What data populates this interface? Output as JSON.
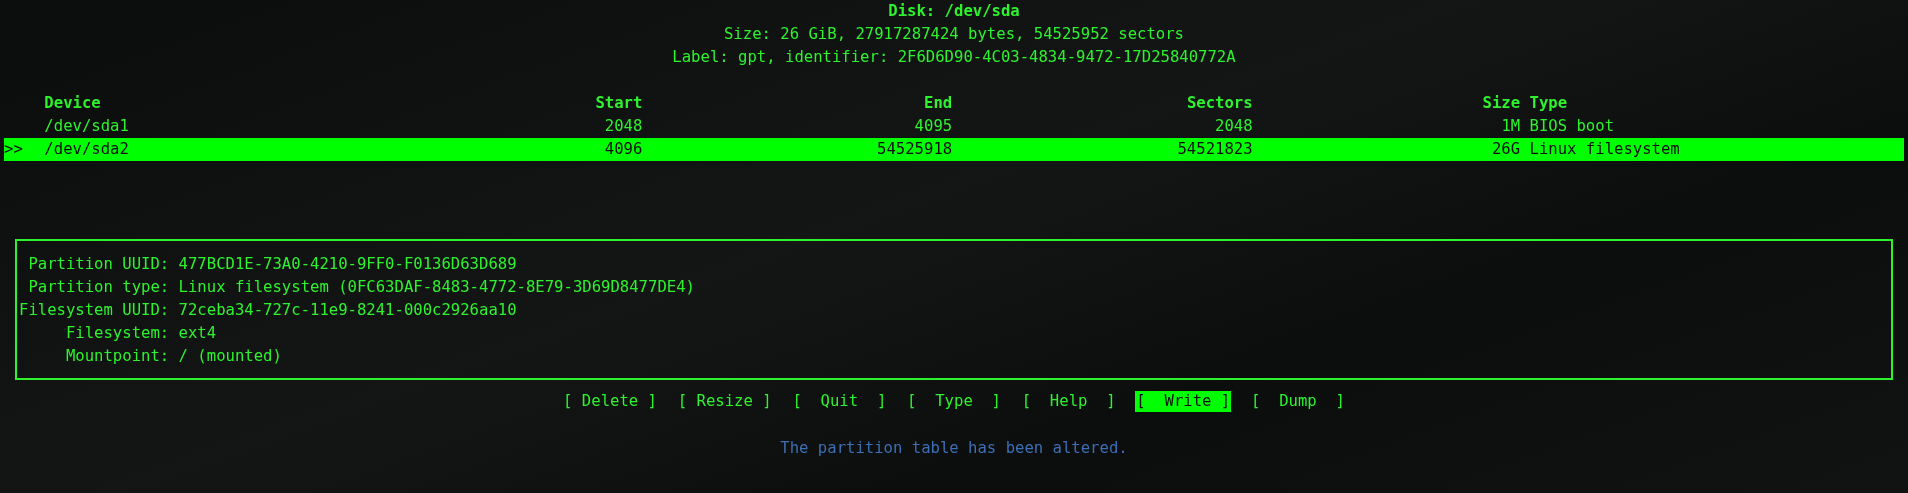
{
  "disk": {
    "title": "Disk: /dev/sda",
    "size_line": "Size: 26 GiB, 27917287424 bytes, 54525952 sectors",
    "label_line": "Label: gpt, identifier: 2F6D6D90-4C03-4834-9472-17D25840772A"
  },
  "table": {
    "columns": [
      "Device",
      "Start",
      "End",
      "Sectors",
      "Size",
      "Type"
    ],
    "rows": [
      {
        "device": "/dev/sda1",
        "start": "2048",
        "end": "4095",
        "sectors": "2048",
        "size": "1M",
        "type": "BIOS boot",
        "selected": false
      },
      {
        "marker": ">>",
        "device": "/dev/sda2",
        "start": "4096",
        "end": "54525918",
        "sectors": "54521823",
        "size": "26G",
        "type": "Linux filesystem",
        "selected": true
      }
    ]
  },
  "details": [
    {
      "label": "Partition UUID:",
      "value": "477BCD1E-73A0-4210-9FF0-F0136D63D689"
    },
    {
      "label": "Partition type:",
      "value": "Linux filesystem (0FC63DAF-8483-4772-8E79-3D69D8477DE4)"
    },
    {
      "label": "Filesystem UUID:",
      "value": "72ceba34-727c-11e9-8241-000c2926aa10"
    },
    {
      "label": "Filesystem:",
      "value": "ext4"
    },
    {
      "label": "Mountpoint:",
      "value": "/ (mounted)"
    }
  ],
  "buttons": [
    {
      "label": "[ Delete ]",
      "selected": false
    },
    {
      "label": "[ Resize ]",
      "selected": false
    },
    {
      "label": "[  Quit  ]",
      "selected": false
    },
    {
      "label": "[  Type  ]",
      "selected": false
    },
    {
      "label": "[  Help  ]",
      "selected": false
    },
    {
      "label": "[  Write ]",
      "selected": true
    },
    {
      "label": "[  Dump  ]",
      "selected": false
    }
  ],
  "message": "The partition table has been altered."
}
